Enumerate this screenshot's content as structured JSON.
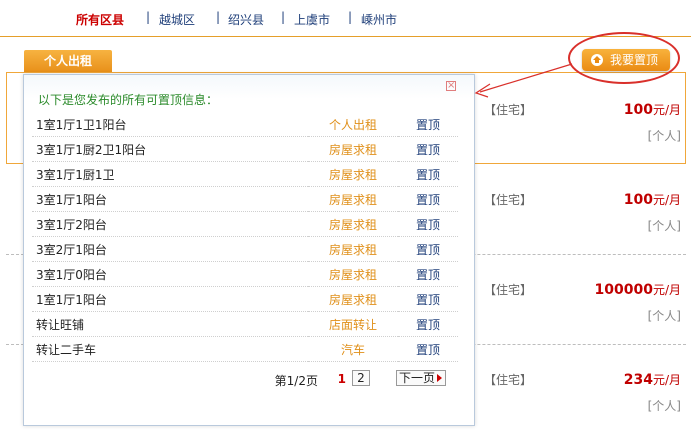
{
  "region_nav": {
    "items": [
      {
        "label": "所有区县",
        "active": true
      },
      {
        "label": "越城区",
        "active": false
      },
      {
        "label": "绍兴县",
        "active": false
      },
      {
        "label": "上虞市",
        "active": false
      },
      {
        "label": "嵊州市",
        "active": false
      }
    ],
    "separator": "|"
  },
  "tab": {
    "label": "个人出租"
  },
  "top_button": {
    "label": "我要置顶",
    "icon": "up-arrow-icon"
  },
  "listings": [
    {
      "type": "【住宅】",
      "price": "100",
      "unit": "元/月",
      "poster": "[个人]"
    },
    {
      "type": "【住宅】",
      "price": "100",
      "unit": "元/月",
      "poster": "[个人]"
    },
    {
      "type": "【住宅】",
      "price": "100000",
      "unit": "元/月",
      "poster": "[个人]"
    },
    {
      "type": "【住宅】",
      "price": "234",
      "unit": "元/月",
      "poster": "[个人]"
    }
  ],
  "modal": {
    "close_symbol": "×",
    "intro": "以下是您发布的所有可置顶信息：",
    "rows": [
      {
        "title": "1室1厅1卫1阳台",
        "category": "个人出租",
        "action": "置顶"
      },
      {
        "title": "3室1厅1厨2卫1阳台",
        "category": "房屋求租",
        "action": "置顶"
      },
      {
        "title": "3室1厅1厨1卫",
        "category": "房屋求租",
        "action": "置顶"
      },
      {
        "title": "3室1厅1阳台",
        "category": "房屋求租",
        "action": "置顶"
      },
      {
        "title": "3室1厅2阳台",
        "category": "房屋求租",
        "action": "置顶"
      },
      {
        "title": "3室2厅1阳台",
        "category": "房屋求租",
        "action": "置顶"
      },
      {
        "title": "3室1厅0阳台",
        "category": "房屋求租",
        "action": "置顶"
      },
      {
        "title": "1室1厅1阳台",
        "category": "房屋求租",
        "action": "置顶"
      },
      {
        "title": "转让旺铺",
        "category": "店面转让",
        "action": "置顶"
      },
      {
        "title": "转让二手车",
        "category": "汽车",
        "action": "置顶"
      }
    ],
    "pager": {
      "info": "第1/2页",
      "current": "1",
      "page2": "2",
      "next": "下一页"
    }
  },
  "colors": {
    "accent": "#e8901a",
    "price": "#c00000",
    "link": "#1f3f7a",
    "highlight": "#d9302b"
  }
}
